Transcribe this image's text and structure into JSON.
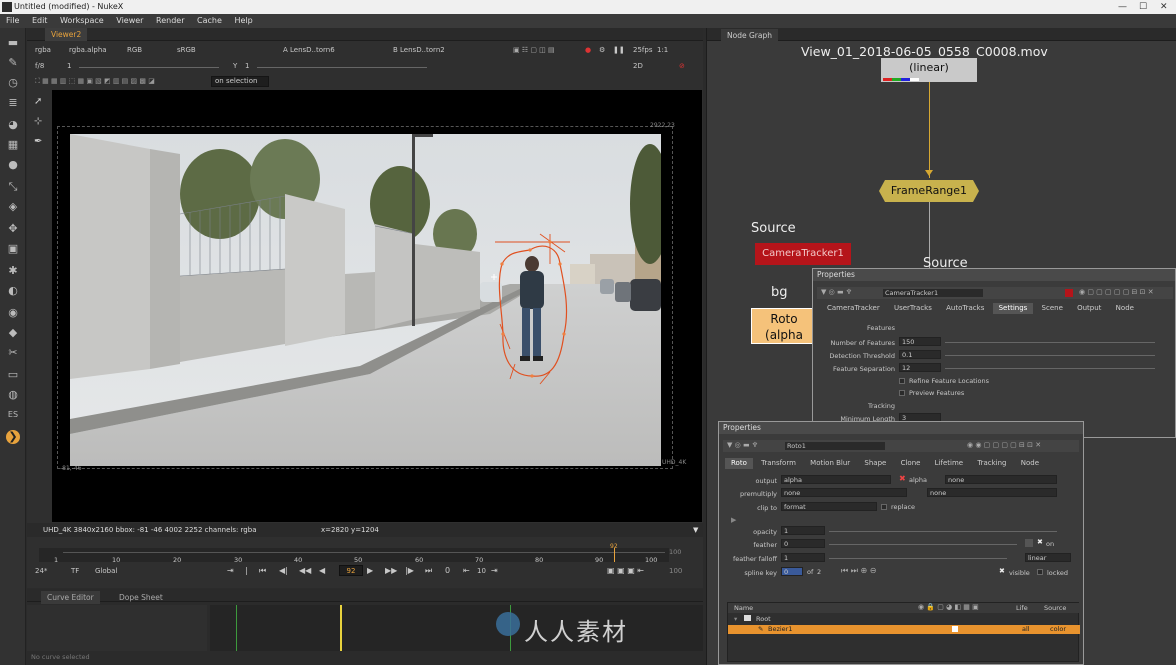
{
  "titlebar": {
    "title": "Untitled (modified) - NukeX",
    "minimize": "—",
    "maximize": "☐",
    "close": "✕"
  },
  "menubar": [
    "File",
    "Edit",
    "Workspace",
    "Viewer",
    "Render",
    "Cache",
    "Help"
  ],
  "viewer_tab": {
    "label": "Viewer2"
  },
  "viewer_controls": {
    "channels": "rgba",
    "alpha": "rgba.alpha",
    "rgb": "RGB",
    "colorspace": "sRGB",
    "input_a": "A  LensD..torn6",
    "input_b": "B  LensD..torn2",
    "gain_label": "f/8",
    "gain_value": "1",
    "y_label": "Y",
    "y_value": "1",
    "mode": "2D",
    "fps": "25fps",
    "zoom": "1:1",
    "roi": "on selection"
  },
  "viewer_labels": {
    "format_top": "2922,23",
    "format_bottom": "UHD_4K",
    "origin": "-81,-46"
  },
  "infobar": {
    "text": "UHD_4K 3840x2160  bbox: -81 -46 4002 2252 channels: rgba",
    "coords": "x=2820 y=1204"
  },
  "timeline": {
    "ticks": [
      "1",
      "10",
      "20",
      "30",
      "40",
      "50",
      "60",
      "70",
      "80",
      "90",
      "100"
    ],
    "start": "1",
    "end": "100",
    "current_frame": "92",
    "fps": "24*",
    "tf": "TF",
    "global": "Global",
    "step": "10",
    "end2": "100"
  },
  "bottom_tabs": [
    "Curve Editor",
    "Dope Sheet"
  ],
  "bottom_status": "No curve selected",
  "node_graph": {
    "tab": "Node Graph",
    "read_label": "View_01_2018-06-05_0558_C0008.mov",
    "read_sub": "(linear)",
    "frame_range": "FrameRange1",
    "camera_tracker": "CameraTracker1",
    "roto_label": "Roto",
    "roto_sub": "(alpha",
    "source1": "Source",
    "source2": "Source",
    "bg": "bg"
  },
  "camtracker_panel": {
    "title": "Properties",
    "node": "CameraTracker1",
    "tabs": [
      "CameraTracker",
      "UserTracks",
      "AutoTracks",
      "Settings",
      "Scene",
      "Output",
      "Node"
    ],
    "section_features": "Features",
    "num_features_label": "Number of Features",
    "num_features": "150",
    "detection_threshold_label": "Detection Threshold",
    "detection_threshold": "0.1",
    "feature_sep_label": "Feature Separation",
    "feature_sep": "12",
    "refine_label": "Refine Feature Locations",
    "preview_label": "Preview Features",
    "section_tracking": "Tracking",
    "min_length_label": "Minimum Length",
    "min_length": "3"
  },
  "roto_panel": {
    "title": "Properties",
    "node": "Roto1",
    "tabs": [
      "Roto",
      "Transform",
      "Motion Blur",
      "Shape",
      "Clone",
      "Lifetime",
      "Tracking",
      "Node"
    ],
    "output_label": "output",
    "output_value": "alpha",
    "output_check": "alpha",
    "output_extra": "none",
    "premult_label": "premultiply",
    "premult_value": "none",
    "premult_extra": "none",
    "clipto_label": "clip to",
    "clipto_value": "format",
    "replace_label": "replace",
    "opacity_label": "opacity",
    "opacity": "1",
    "feather_label": "feather",
    "feather": "0",
    "falloff_label": "feather falloff",
    "falloff": "1",
    "falloff_mode": "linear",
    "spline_label": "spline key",
    "spline_key": "0",
    "spline_of": "of",
    "spline_total": "2",
    "visible_label": "visible",
    "locked_label": "locked",
    "on_label": "on",
    "cols": [
      "Name",
      "Life",
      "Source"
    ],
    "rows": [
      {
        "name": "Root",
        "life": "",
        "source": ""
      },
      {
        "name": "Bezier1",
        "life": "all",
        "source": "color"
      }
    ]
  },
  "watermark": "人人素材",
  "colors": {
    "accent": "#e8a33d",
    "selected_row": "#e8932e",
    "node_red": "#b5141a",
    "node_roto": "#f5c27a",
    "node_framerange": "#c8b24d"
  }
}
